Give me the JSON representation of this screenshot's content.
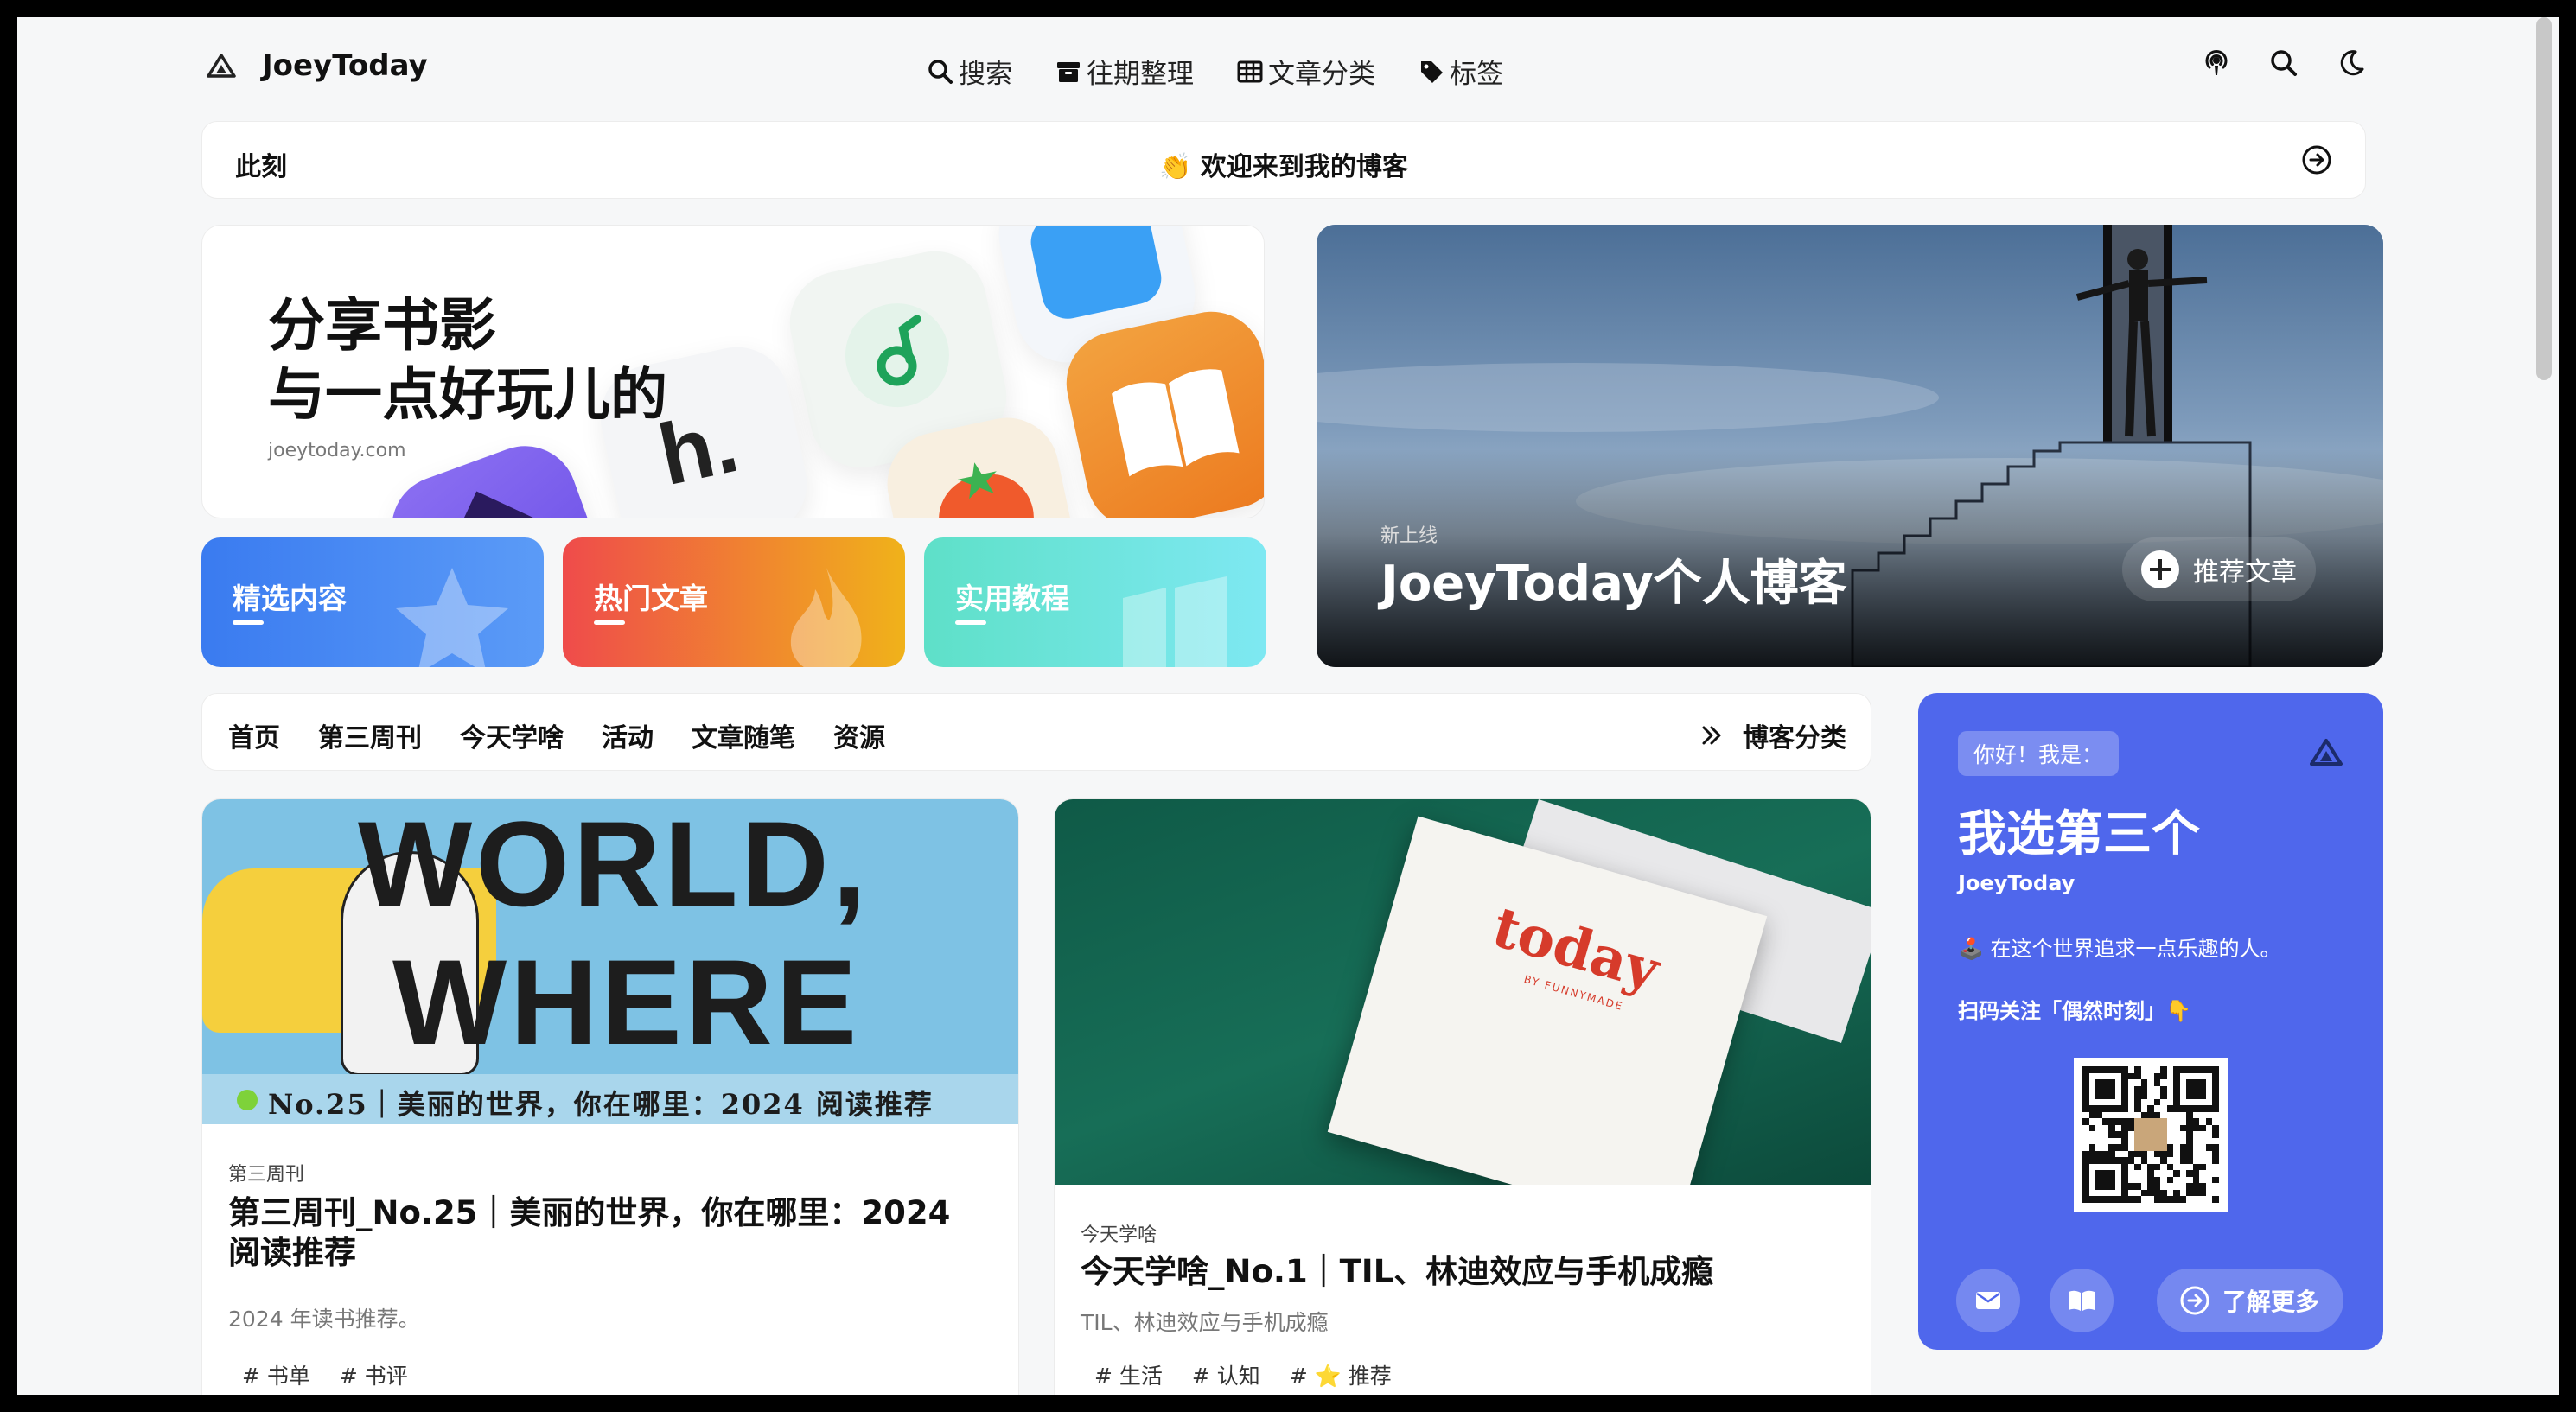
{
  "header": {
    "brand": "JoeyToday",
    "nav": [
      {
        "label": "搜索",
        "icon": "search-icon"
      },
      {
        "label": "往期整理",
        "icon": "archive-icon"
      },
      {
        "label": "文章分类",
        "icon": "table-icon"
      },
      {
        "label": "标签",
        "icon": "tag-icon"
      }
    ],
    "icons": [
      "podcast-icon",
      "search-icon",
      "moon-icon"
    ]
  },
  "announcement": {
    "label": "此刻",
    "text": "👏 欢迎来到我的博客"
  },
  "banner": {
    "title_line1": "分享书影",
    "title_line2": "与一点好玩儿的",
    "url": "joeytoday.com"
  },
  "categories": [
    {
      "label": "精选内容",
      "color_start": "#3a7bf0",
      "color_end": "#5b9bf7"
    },
    {
      "label": "热门文章",
      "color_start": "#ef4b4b",
      "color_end": "#f0b21a"
    },
    {
      "label": "实用教程",
      "color_start": "#5ee0c8",
      "color_end": "#7ee8f2"
    }
  ],
  "hero": {
    "kicker": "新上线",
    "title": "JoeyToday个人博客",
    "button": "推荐文章"
  },
  "category_bar": {
    "tabs": [
      "首页",
      "第三周刊",
      "今天学啥",
      "活动",
      "文章随笔",
      "资源"
    ],
    "more": "博客分类"
  },
  "posts": [
    {
      "image_title_1": "WORLD,",
      "image_title_2": "WHERE",
      "image_caption": "No.25｜美丽的世界，你在哪里：2024 阅读推荐",
      "category": "第三周刊",
      "title": "第三周刊_No.25｜美丽的世界，你在哪里：2024 阅读推荐",
      "desc": "2024 年读书推荐。",
      "tags": [
        "# 书单",
        "# 书评"
      ]
    },
    {
      "image_brand": "today",
      "image_sub": "BY FUNNYMADE",
      "category": "今天学啥",
      "title": "今天学啥_No.1｜TIL、林迪效应与手机成瘾",
      "desc": "TIL、林迪效应与手机成瘾",
      "tags": [
        "# 生活",
        "# 认知",
        "# ⭐ 推荐"
      ]
    }
  ],
  "profile": {
    "badge": "你好！我是：",
    "heading": "我选第三个",
    "name": "JoeyToday",
    "bio": "🕹️ 在这个世界追求一点乐趣的人。",
    "cta": "扫码关注「偶然时刻」👇",
    "more": "了解更多",
    "color": "#4f67ec"
  }
}
